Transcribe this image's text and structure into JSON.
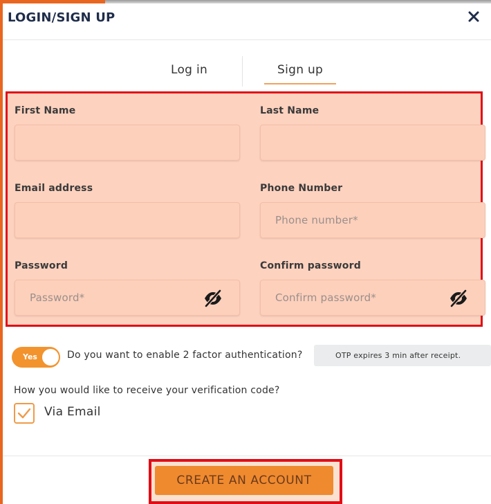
{
  "modal": {
    "title": "LOGIN/SIGN UP",
    "close_icon": "close-icon"
  },
  "tabs": [
    {
      "label": "Log in",
      "active": false
    },
    {
      "label": "Sign up",
      "active": true
    }
  ],
  "form": {
    "first_name": {
      "label": "First Name",
      "value": "",
      "placeholder": ""
    },
    "last_name": {
      "label": "Last Name",
      "value": "",
      "placeholder": ""
    },
    "email": {
      "label": "Email address",
      "value": "",
      "placeholder": ""
    },
    "phone": {
      "label": "Phone Number",
      "value": "",
      "placeholder": "Phone number*"
    },
    "password": {
      "label": "Password",
      "value": "",
      "placeholder": "Password*",
      "icon": "eye-slash-icon"
    },
    "confirm_password": {
      "label": "Confirm password",
      "value": "",
      "placeholder": "Confirm password*",
      "icon": "eye-slash-icon"
    }
  },
  "two_factor": {
    "toggle_label": "Yes",
    "enabled": true,
    "question": "Do you want to enable 2 factor authentication?",
    "otp_note": "OTP expires 3 min after receipt."
  },
  "verification": {
    "question": "How you would like to receive your verification code?",
    "option_label": "Via Email",
    "checked": true
  },
  "cta": {
    "label": "CREATE AN ACCOUNT"
  },
  "colors": {
    "accent": "#ef8a2f",
    "highlight_border": "#e10c16",
    "form_highlight": "#fdd2bf",
    "title": "#1f2d4a"
  }
}
